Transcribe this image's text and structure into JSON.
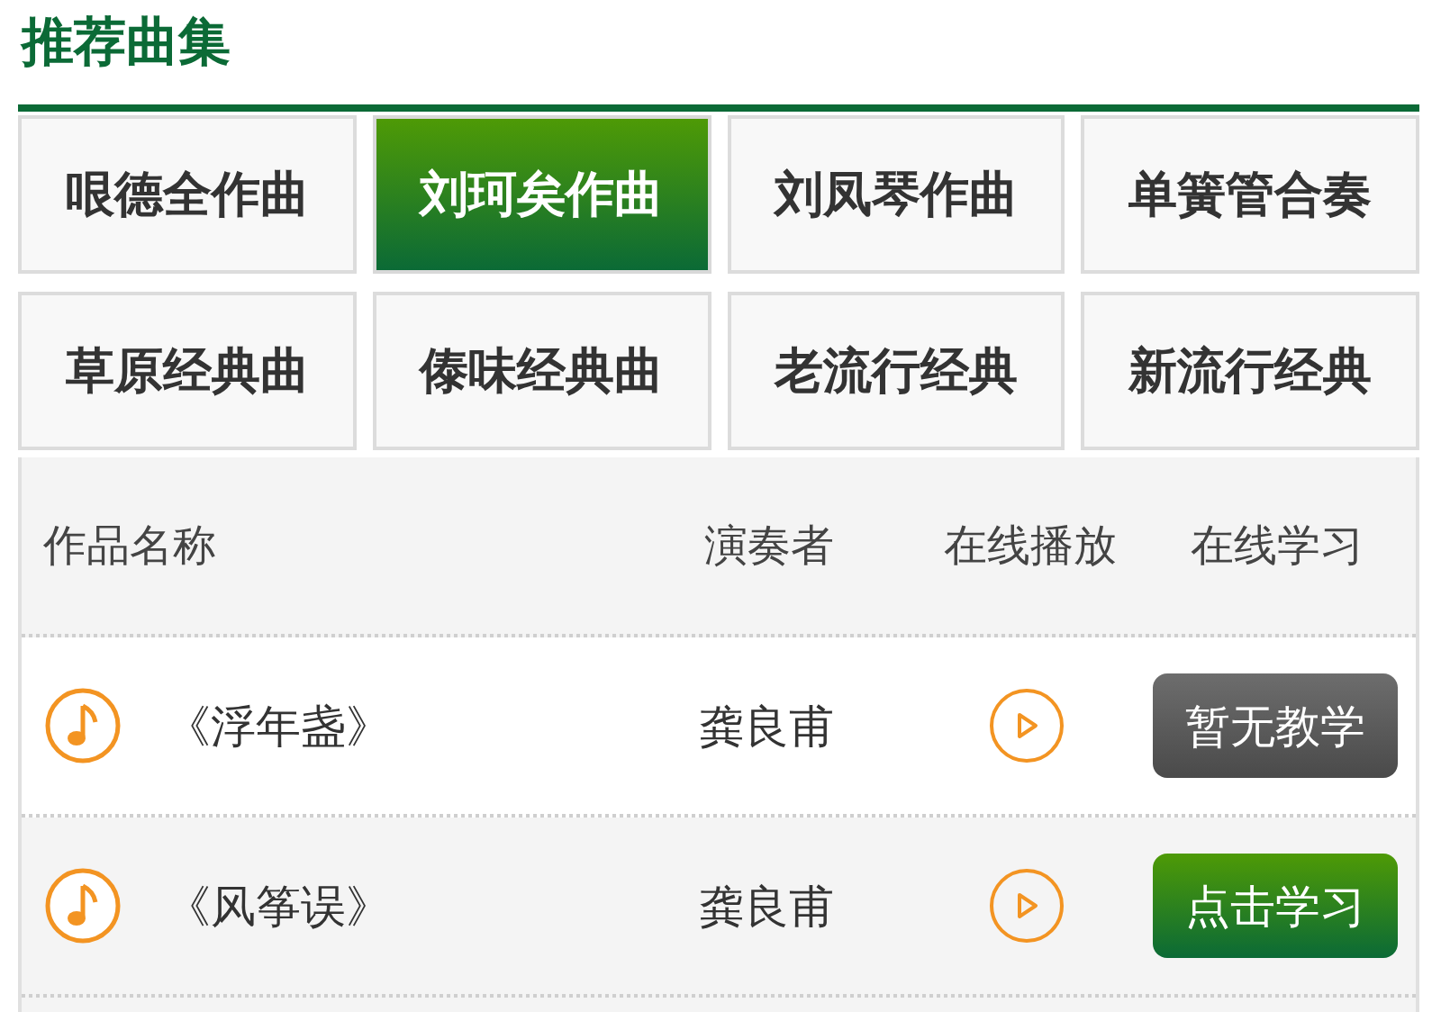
{
  "title": "推荐曲集",
  "categories": [
    {
      "label": "哏德全作曲",
      "selected": false
    },
    {
      "label": "刘珂矣作曲",
      "selected": true
    },
    {
      "label": "刘凤琴作曲",
      "selected": false
    },
    {
      "label": "单簧管合奏",
      "selected": false
    },
    {
      "label": "草原经典曲",
      "selected": false
    },
    {
      "label": "傣味经典曲",
      "selected": false
    },
    {
      "label": "老流行经典",
      "selected": false
    },
    {
      "label": "新流行经典",
      "selected": false
    }
  ],
  "table": {
    "columns": [
      "作品名称",
      "演奏者",
      "在线播放",
      "在线学习"
    ],
    "rows": [
      {
        "name": "《浮年盏》",
        "performer": "龚良甫",
        "study": {
          "label": "暂无教学",
          "kind": "unavailable"
        }
      },
      {
        "name": "《风筝误》",
        "performer": "龚良甫",
        "study": {
          "label": "点击学习",
          "kind": "available"
        }
      }
    ]
  }
}
